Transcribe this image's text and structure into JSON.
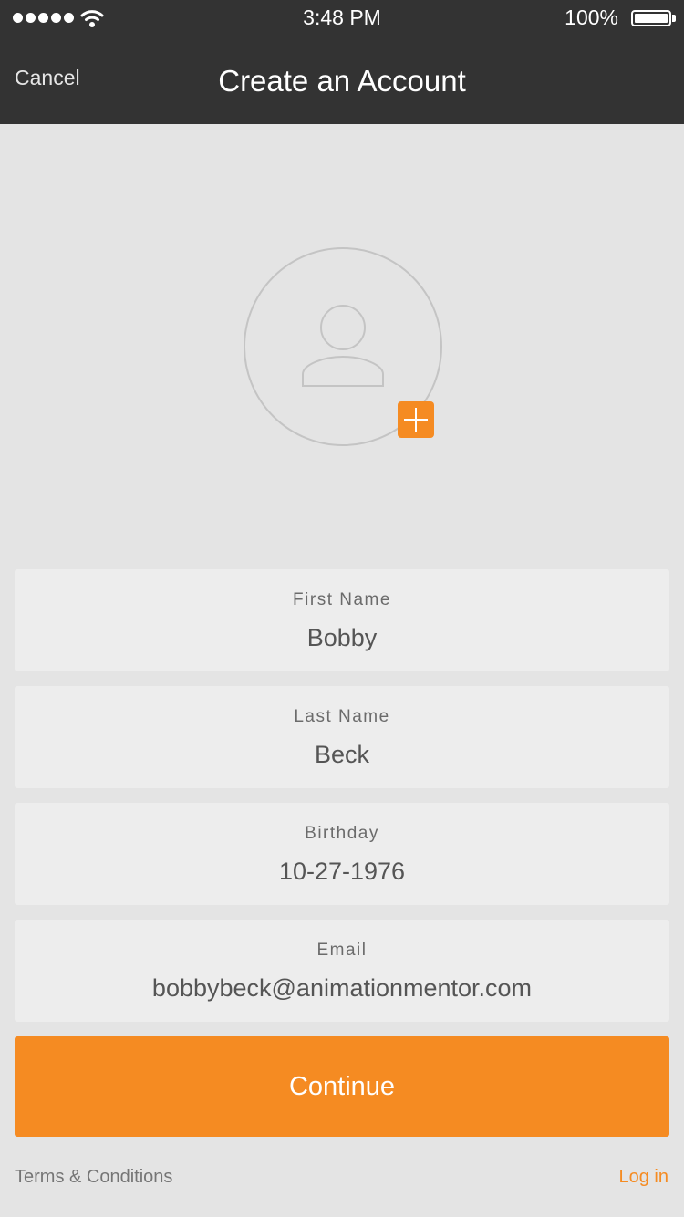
{
  "status_bar": {
    "time": "3:48 PM",
    "battery": "100%",
    "icons": [
      "signal-dots-icon",
      "wifi-icon",
      "battery-icon"
    ]
  },
  "nav": {
    "cancel_label": "Cancel",
    "title": "Create an Account"
  },
  "avatar": {
    "placeholder_icon": "person-icon",
    "add_icon": "plus-icon"
  },
  "form": {
    "first_name": {
      "label": "First Name",
      "value": "Bobby"
    },
    "last_name": {
      "label": "Last Name",
      "value": "Beck"
    },
    "birthday": {
      "label": "Birthday",
      "value": "10-27-1976"
    },
    "email": {
      "label": "Email",
      "value": "bobbybeck@animationmentor.com"
    }
  },
  "continue_label": "Continue",
  "footer": {
    "terms_label": "Terms & Conditions",
    "login_label": "Log in"
  },
  "colors": {
    "accent": "#f58b22",
    "nav_background": "#333333",
    "page_background": "#e4e4e4",
    "field_background": "#ededed"
  }
}
